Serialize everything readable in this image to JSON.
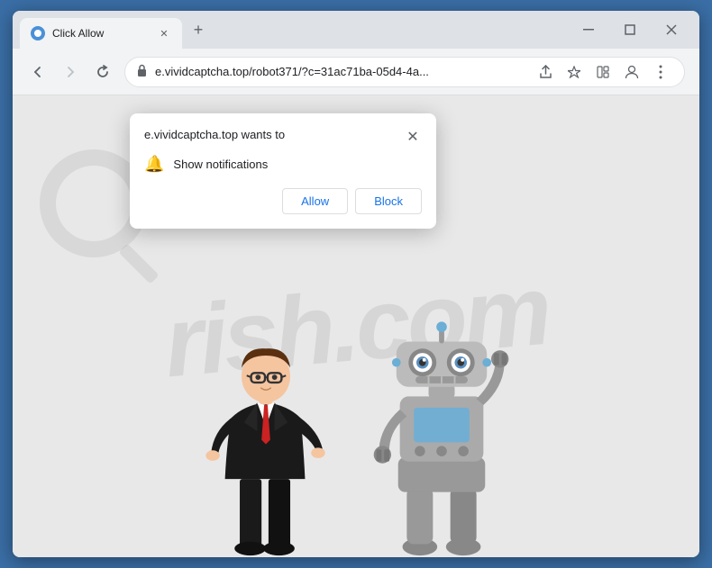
{
  "browser": {
    "tab": {
      "title": "Click Allow",
      "favicon_label": "favicon"
    },
    "new_tab_icon": "+",
    "window_controls": {
      "minimize": "—",
      "maximize": "□",
      "close": "✕"
    },
    "nav": {
      "back": "←",
      "forward": "→",
      "refresh": "↻",
      "lock_icon": "🔒",
      "address": "e.vividcaptcha.top/robot371/?c=31ac71ba-05d4-4a...",
      "share_icon": "⬆",
      "star_icon": "☆",
      "extension_icon": "▭",
      "profile_icon": "👤",
      "menu_icon": "⋮"
    },
    "popup": {
      "title": "e.vividcaptcha.top wants to",
      "close_icon": "✕",
      "notification_icon": "🔔",
      "notification_text": "Show notifications",
      "allow_label": "Allow",
      "block_label": "Block"
    },
    "page": {
      "watermark": "rish.com"
    }
  }
}
